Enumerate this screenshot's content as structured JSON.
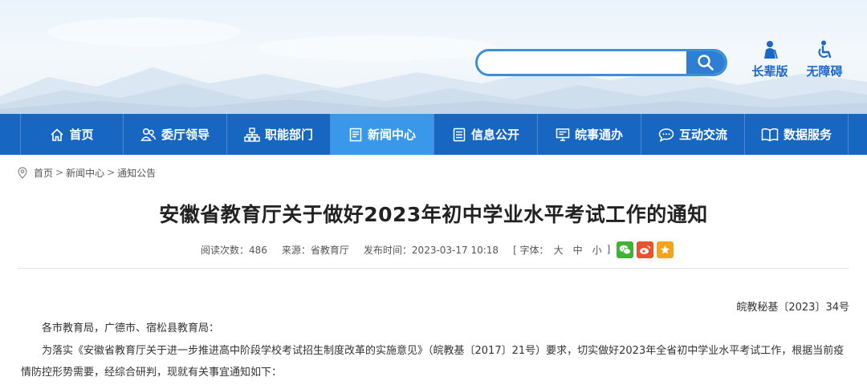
{
  "header": {
    "search": {
      "value": "",
      "placeholder": ""
    },
    "tools": [
      {
        "label": "长辈版",
        "icon": "elder-icon"
      },
      {
        "label": "无障碍",
        "icon": "wheelchair-icon"
      }
    ]
  },
  "nav": {
    "items": [
      {
        "label": "首页",
        "icon": "home-icon"
      },
      {
        "label": "委厅领导",
        "icon": "users-icon"
      },
      {
        "label": "职能部门",
        "icon": "org-chart-icon"
      },
      {
        "label": "新闻中心",
        "icon": "document-icon",
        "active": true
      },
      {
        "label": "信息公开",
        "icon": "list-icon"
      },
      {
        "label": "皖事通办",
        "icon": "monitor-icon"
      },
      {
        "label": "互动交流",
        "icon": "chat-icon"
      },
      {
        "label": "数据服务",
        "icon": "book-icon"
      }
    ]
  },
  "breadcrumb": {
    "items": [
      "首页",
      "新闻中心",
      "通知公告"
    ],
    "separator": ">"
  },
  "article": {
    "title": "安徽省教育厅关于做好2023年初中学业水平考试工作的通知",
    "meta": {
      "views": "阅读次数：486",
      "source": "来源：省教育厅",
      "published": "发布时间：2023-03-17 10:18",
      "font_label": "[ 字体：",
      "font_large": "大",
      "font_medium": "中",
      "font_small": "小",
      "font_end": "]"
    },
    "doc_number": "皖教秘基〔2023〕34号",
    "salutation": "各市教育局，广德市、宿松县教育局：",
    "body": "为落实《安徽省教育厅关于进一步推进高中阶段学校考试招生制度改革的实施意见》（皖教基〔2017〕21号）要求，切实做好2023年全省初中学业水平考试工作，根据当前疫情防控形势需要，经综合研判，现就有关事宜通知如下："
  },
  "colors": {
    "nav_bg": "#1767c2",
    "nav_active": "#3a98ea",
    "accent": "#1c68c6",
    "wechat": "#3fb335",
    "weibo": "#e8532f",
    "favorite": "#f2a51b"
  }
}
